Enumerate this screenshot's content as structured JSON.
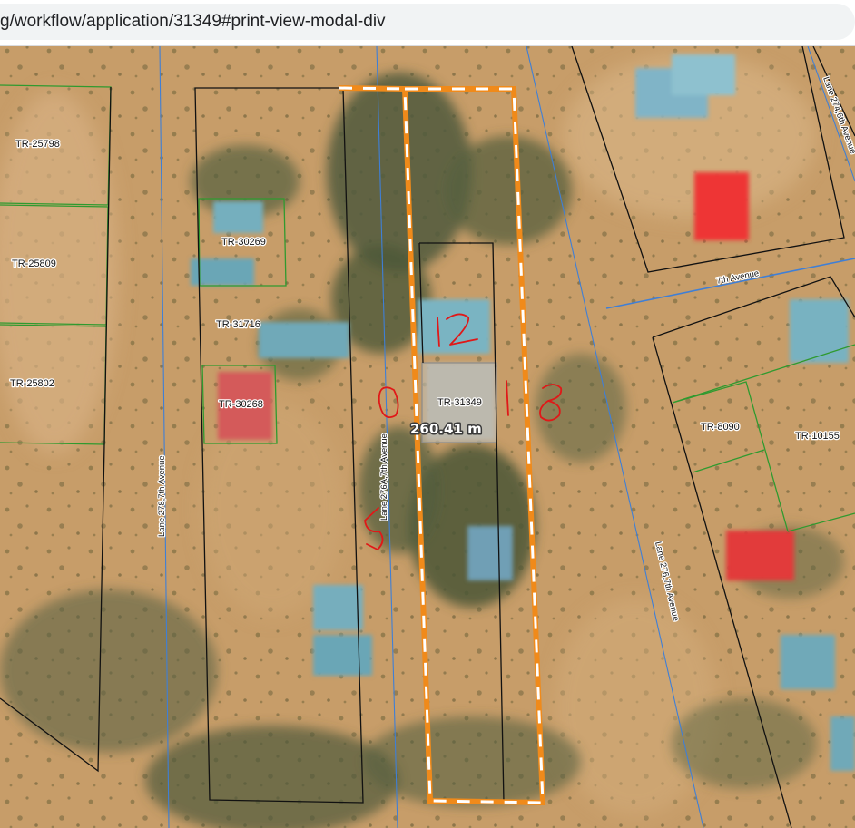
{
  "browser": {
    "url_text": "g/workflow/application/31349#print-view-modal-div"
  },
  "map": {
    "parcels": {
      "p25798": "TR-25798",
      "p25809": "TR-25809",
      "p25802": "TR-25802",
      "p30269": "TR-30269",
      "p31716": "TR-31716",
      "p30268": "TR-30268",
      "p31349": "TR-31349",
      "p8090": "TR-8090",
      "p10155": "TR-10155"
    },
    "roads": {
      "lane278": "Lane 278,7th Avenue",
      "lane276a": "Lane 276A,7th Avenue",
      "lane276": "Lane 276,7th Avenue",
      "lane274": "Lane 274,6th Avenue",
      "avenue7": "7th Avenue"
    },
    "measurement": "260.41 m",
    "annotations": {
      "left": "50",
      "top": "12",
      "right": "18"
    },
    "colors": {
      "ground": "#c59a66",
      "vegetation": "#4e5a3a",
      "roof_blue": "#6fa9b8",
      "roof_red": "#e23a3a",
      "selected_outline": "#f08a1a",
      "parcel_black": "#111111",
      "parcel_green": "#2f9a2f",
      "road_line": "#3f7fd6",
      "annotation_red": "#e01818"
    }
  }
}
